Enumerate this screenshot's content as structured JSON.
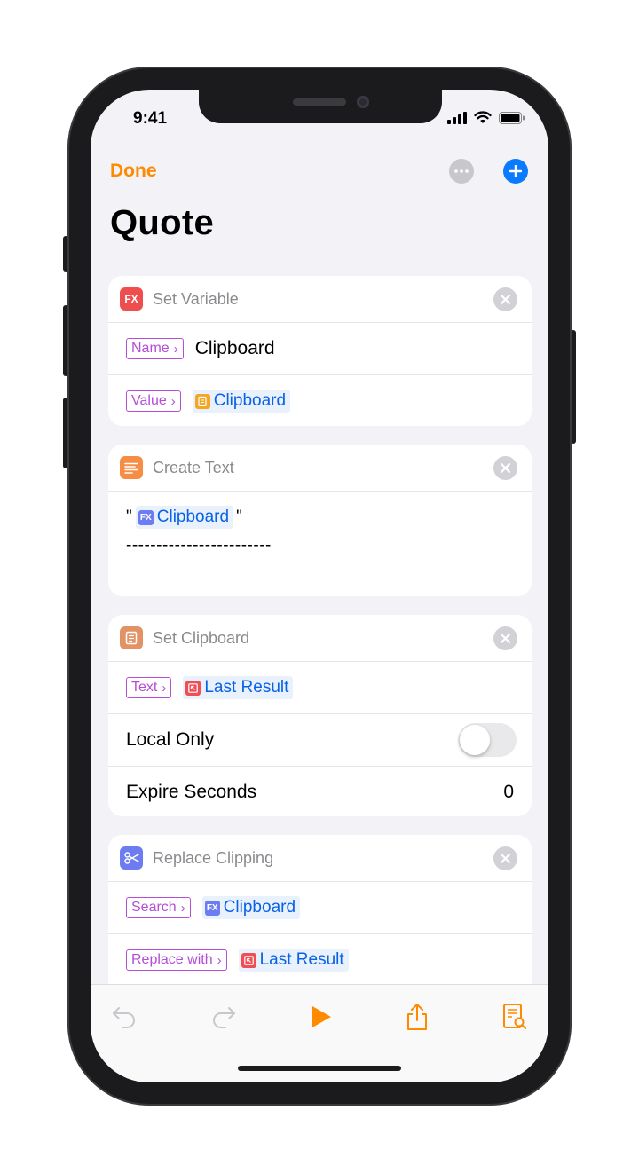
{
  "status_bar": {
    "time": "9:41"
  },
  "nav": {
    "done_label": "Done",
    "title": "Quote"
  },
  "colors": {
    "accent": "#ff8a00",
    "blue": "#0a7aff",
    "param": "#b44dd8"
  },
  "actions": {
    "set_variable": {
      "title": "Set Variable",
      "icon": "fx-icon",
      "name_param": "Name",
      "name_value": "Clipboard",
      "value_param": "Value",
      "value_token": "Clipboard"
    },
    "create_text": {
      "title": "Create Text",
      "icon": "text-lines-icon",
      "quote_open": "\"",
      "token": "Clipboard",
      "quote_close": "\"",
      "dashes": "------------------------"
    },
    "set_clipboard": {
      "title": "Set Clipboard",
      "icon": "clipboard-icon",
      "text_param": "Text",
      "text_token": "Last Result",
      "local_only_label": "Local Only",
      "local_only": false,
      "expire_label": "Expire Seconds",
      "expire_value": "0"
    },
    "replace_clipping": {
      "title": "Replace Clipping",
      "icon": "scissors-icon",
      "search_param": "Search",
      "search_token": "Clipboard",
      "replace_param": "Replace with",
      "replace_token": "Last Result"
    }
  }
}
